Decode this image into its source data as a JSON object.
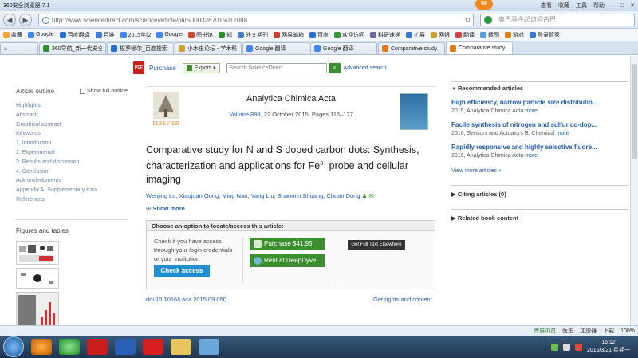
{
  "window": {
    "app_title": "360安全浏览器 7.1",
    "badge": "68",
    "menu": [
      "查看",
      "收藏",
      "工具",
      "帮助"
    ]
  },
  "address_bar": {
    "url": "http://www.sciencedirect.com/science/article/pii/S0003267015012088",
    "search_placeholder": "奥巴马今起访问古巴"
  },
  "bookmarks": [
    "收藏",
    "Google",
    "百度翻译",
    "百链",
    "2015年(2",
    "Google",
    "图书馆",
    "知",
    "外文期刊",
    "网易邮箱",
    "百度",
    "欢迎访问",
    "科研速递",
    "扩展",
    "网银",
    "翻译",
    "截图",
    "游戏",
    "登录管家"
  ],
  "tabs": [
    {
      "label": "360导航_新一代安全",
      "active": false
    },
    {
      "label": "梭罗嗲尔_百度搜索",
      "active": false
    },
    {
      "label": "小木虫论坛 - 学术科",
      "active": false
    },
    {
      "label": "Google 翻译",
      "active": false
    },
    {
      "label": "Google 翻译",
      "active": false
    },
    {
      "label": "Comparative study",
      "active": false
    },
    {
      "label": "Comparative study",
      "active": true
    }
  ],
  "toolbar": {
    "pdf_label": "PDF",
    "purchase_label": "Purchase",
    "export_label": "Export",
    "search_placeholder": "Search ScienceDirect",
    "advanced_search": "Advanced search"
  },
  "outline": {
    "heading": "Article outline",
    "show_full": "Show full outline",
    "items": [
      "Highlights",
      "Abstract",
      "Graphical abstract",
      "Keywords",
      "1. Introduction",
      "2. Experimental",
      "3. Results and discussion",
      "4. Conclusion",
      "Acknowledgments",
      "Appendix A. Supplementary data",
      "References"
    ],
    "figures_heading": "Figures and tables"
  },
  "journal": {
    "publisher": "ELSEVIER",
    "name": "Analytica Chimica Acta",
    "volume_link": "Volume 898",
    "issue_rest": ", 22 October 2015, Pages 116–127"
  },
  "article": {
    "title_part1": "Comparative study for N and S doped carbon dots: Synthesis, characterization and applications for Fe",
    "title_sup": "3+",
    "title_part2": " probe and cellular imaging",
    "authors": "Wenjing Lu, Xiaojuan Gong, Ming Nan, Yang Liu, Shaomin Shuang, Chuan Dong",
    "show_more": "Show more",
    "doi": "doi:10.1016/j.aca.2015.09.050",
    "rights": "Get rights and content"
  },
  "access": {
    "heading": "Choose an option to locate/access this article:",
    "text": "Check if you have access through your login credentials or your institution",
    "check_access": "Check access",
    "purchase": "Purchase $41.95",
    "rent": "Rent at DeepDyve",
    "get_full": "Get Full Text Elsewhere"
  },
  "recommended": {
    "heading": "Recommended articles",
    "items": [
      {
        "title": "High efficiency, narrow particle size distributio...",
        "meta": "2015, Analytica Chimica Acta",
        "more": "more"
      },
      {
        "title": "Facile synthesis of nitrogen and sulfur co-dop...",
        "meta": "2016, Sensors and Actuators B: Chemical",
        "more": "more"
      },
      {
        "title": "Rapidly responsive and highly selective fluore...",
        "meta": "2016, Analytica Chimica Acta",
        "more": "more"
      }
    ],
    "view_more": "View more articles »",
    "citing": "Citing articles (0)",
    "related": "Related book content"
  },
  "statusbar": {
    "items": [
      "加速器",
      "下载",
      "100%"
    ],
    "highlight": "跨屏浏览",
    "doctor": "医生"
  },
  "taskbar": {
    "time": "16:12",
    "date": "2016/3/21 星期一"
  }
}
